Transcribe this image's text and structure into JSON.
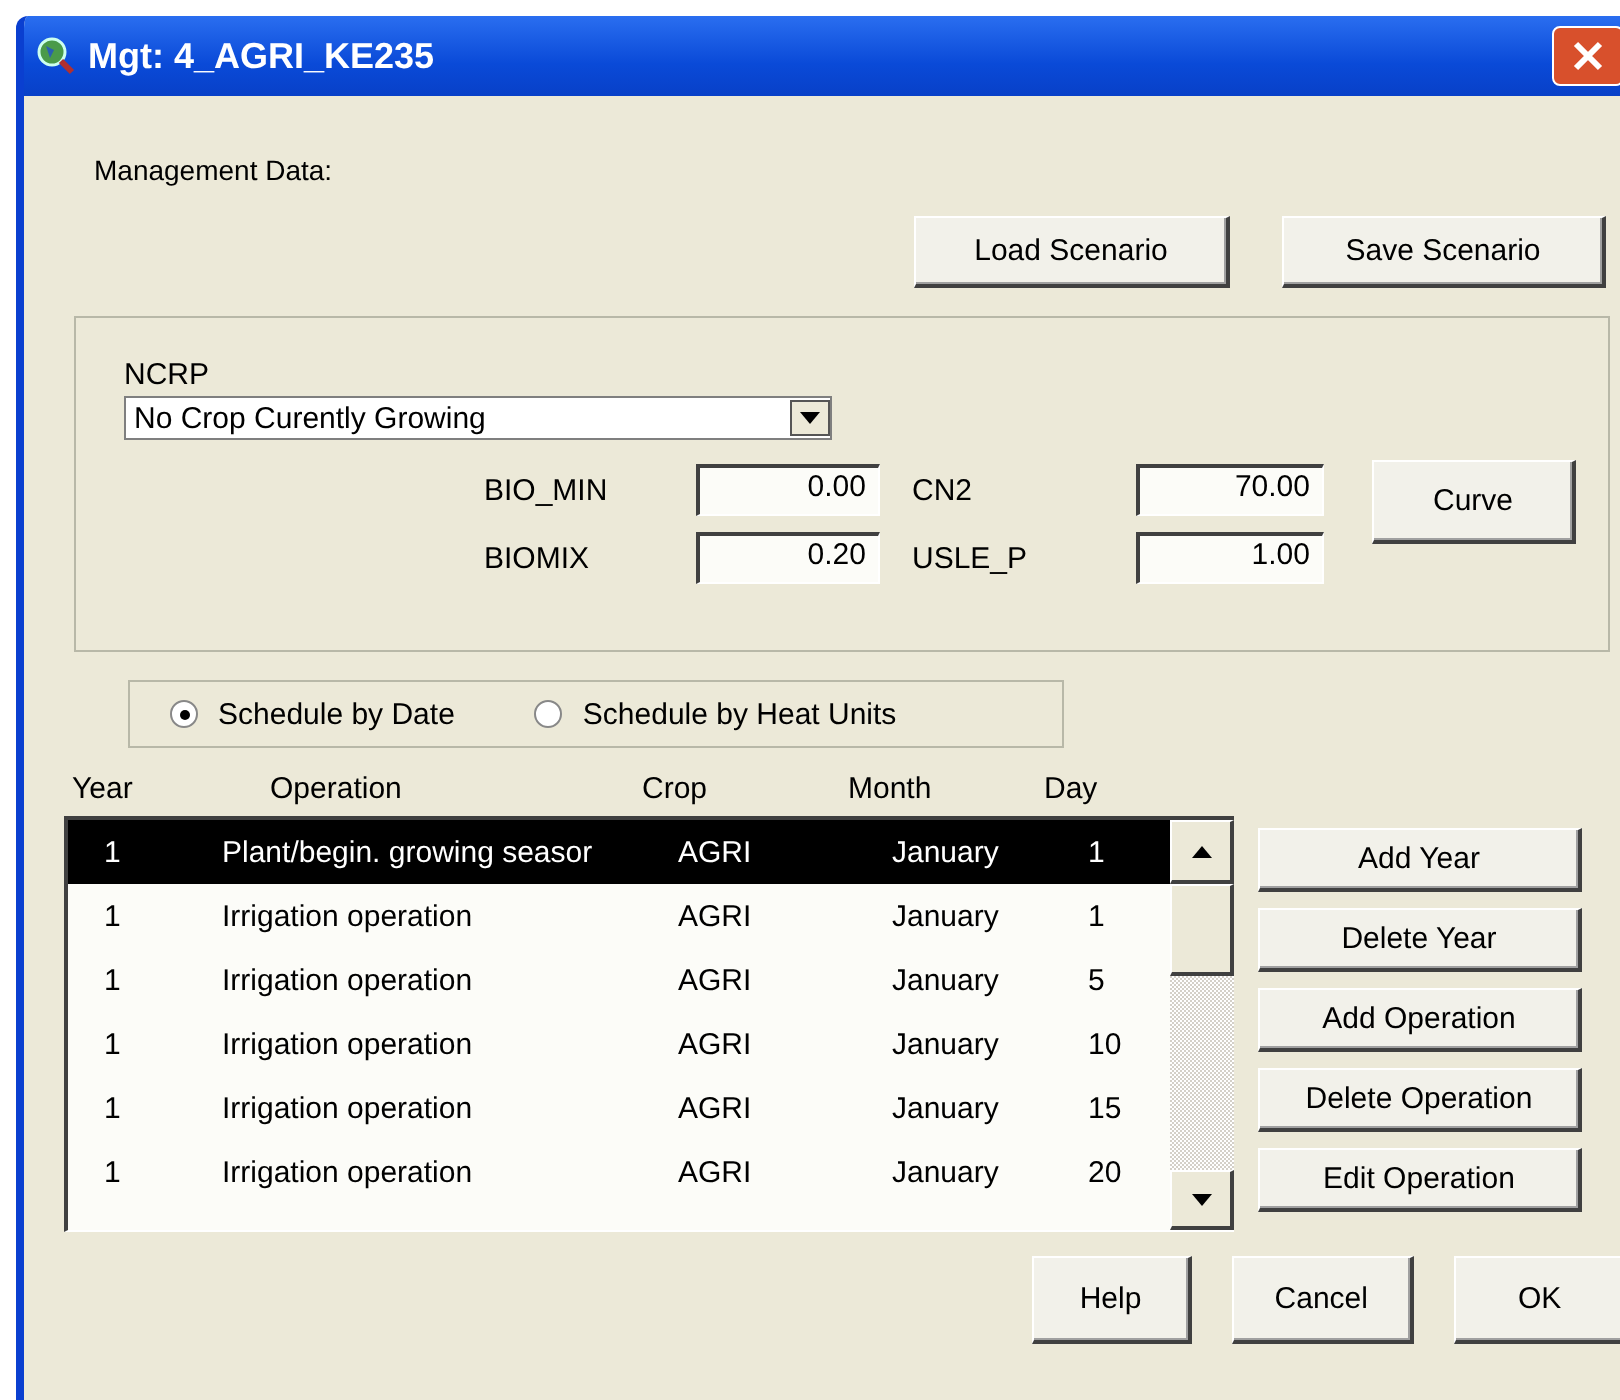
{
  "window": {
    "title": "Mgt: 4_AGRI_KE235"
  },
  "heading": "Management Data:",
  "scenario_buttons": [
    "Load Scenario",
    "Save Scenario"
  ],
  "crop": {
    "label": "NCRP",
    "value": "No Crop Curently Growing"
  },
  "parameters": [
    {
      "label": "BIO_MIN",
      "value": "0.00"
    },
    {
      "label": "CN2",
      "value": "70.00"
    },
    {
      "label": "BIOMIX",
      "value": "0.20"
    },
    {
      "label": "USLE_P",
      "value": "1.00"
    }
  ],
  "curve_button": "Curve",
  "schedule_modes": [
    {
      "label": "Schedule by Date",
      "selected": true
    },
    {
      "label": "Schedule by Heat Units",
      "selected": false
    }
  ],
  "table": {
    "columns": [
      "Year",
      "Operation",
      "Crop",
      "Month",
      "Day"
    ],
    "rows": [
      {
        "cells": [
          "1",
          "Plant/begin. growing seasor",
          "AGRI",
          "January",
          "1"
        ],
        "selected": true
      },
      {
        "cells": [
          "1",
          "Irrigation operation",
          "AGRI",
          "January",
          "1"
        ],
        "selected": false
      },
      {
        "cells": [
          "1",
          "Irrigation operation",
          "AGRI",
          "January",
          "5"
        ],
        "selected": false
      },
      {
        "cells": [
          "1",
          "Irrigation operation",
          "AGRI",
          "January",
          "10"
        ],
        "selected": false
      },
      {
        "cells": [
          "1",
          "Irrigation operation",
          "AGRI",
          "January",
          "15"
        ],
        "selected": false
      },
      {
        "cells": [
          "1",
          "Irrigation operation",
          "AGRI",
          "January",
          "20"
        ],
        "selected": false
      }
    ]
  },
  "operation_buttons": [
    "Add Year",
    "Delete Year",
    "Add Operation",
    "Delete Operation",
    "Edit Operation"
  ],
  "dialog_buttons": [
    "Help",
    "Cancel",
    "OK"
  ]
}
